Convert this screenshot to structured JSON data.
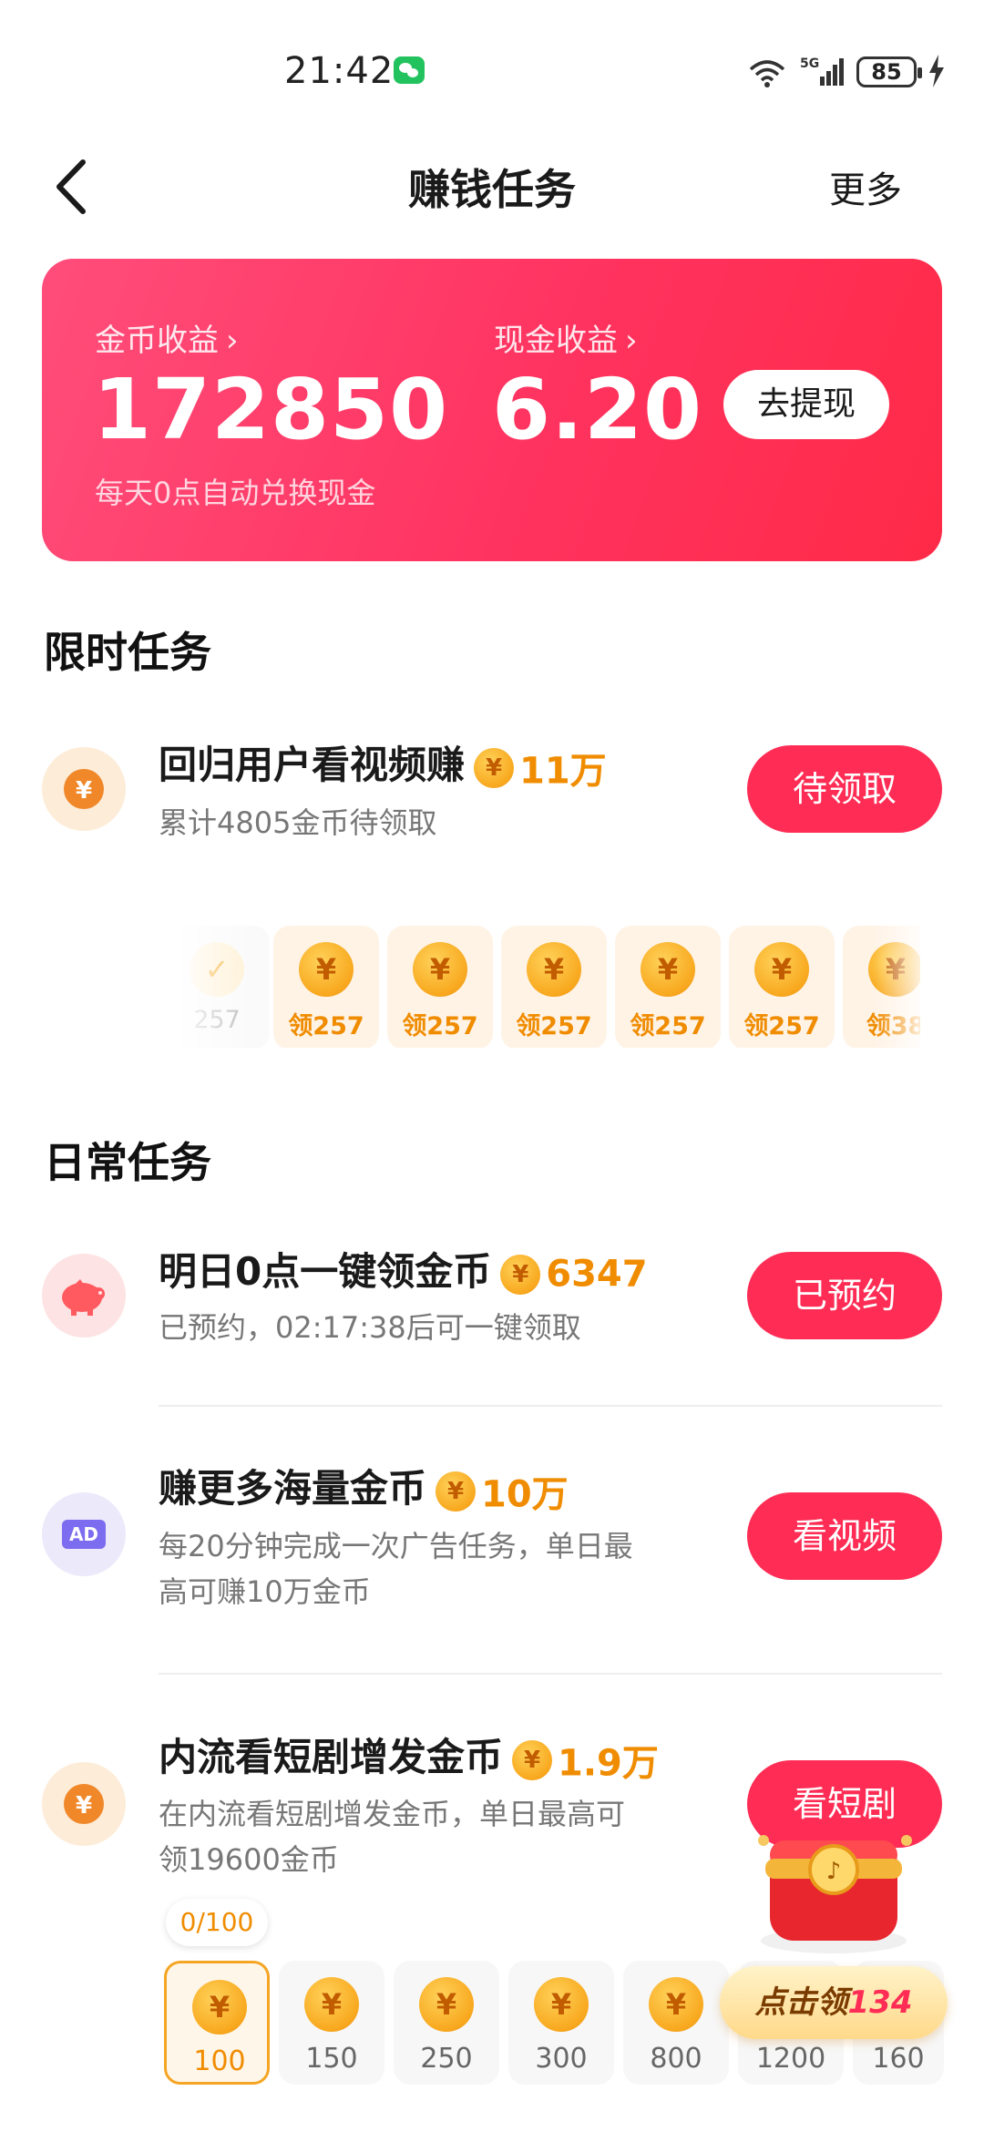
{
  "status_bar": {
    "time": "21:42",
    "battery": "85"
  },
  "nav": {
    "title": "赚钱任务",
    "more": "更多"
  },
  "earnings": {
    "coins_label": "金币收益",
    "coins_value": "172850",
    "cash_label": "现金收益",
    "cash_value": "6.20",
    "withdraw_label": "去提现",
    "note": "每天0点自动兑换现金"
  },
  "limited": {
    "section_title": "限时任务",
    "task": {
      "title": "回归用户看视频赚",
      "reward": "11万",
      "desc": "累计4805金币待领取",
      "button": "待领取"
    },
    "claims": [
      {
        "label": "257",
        "state": "done"
      },
      {
        "label": "领257",
        "state": "available"
      },
      {
        "label": "领257",
        "state": "available"
      },
      {
        "label": "领257",
        "state": "available"
      },
      {
        "label": "领257",
        "state": "available"
      },
      {
        "label": "领257",
        "state": "available"
      },
      {
        "label": "领38",
        "state": "available"
      }
    ]
  },
  "daily": {
    "section_title": "日常任务",
    "tasks": [
      {
        "title": "明日0点一键领金币",
        "reward": "6347",
        "desc": "已预约，02:17:38后可一键领取",
        "button": "已预约"
      },
      {
        "title": "赚更多海量金币",
        "reward": "10万",
        "desc_line1": "每20分钟完成一次广告任务，单日最",
        "desc_line2": "高可赚10万金币",
        "button": "看视频",
        "icon_text": "AD"
      },
      {
        "title": "内流看短剧增发金币",
        "reward": "1.9万",
        "desc_line1": "在内流看短剧增发金币，单日最高可",
        "desc_line2": "领19600金币",
        "button": "看短剧",
        "progress": "0/100",
        "steps": [
          "100",
          "150",
          "250",
          "300",
          "800",
          "1200",
          "160"
        ]
      }
    ]
  },
  "float_widget": {
    "prefix": "点击领",
    "number": "134"
  },
  "coin_symbol": "¥",
  "colors": {
    "accent": "#ff2d55",
    "coin": "#f08c00",
    "card_start": "#ff4d7a",
    "card_end": "#ff2a47"
  }
}
